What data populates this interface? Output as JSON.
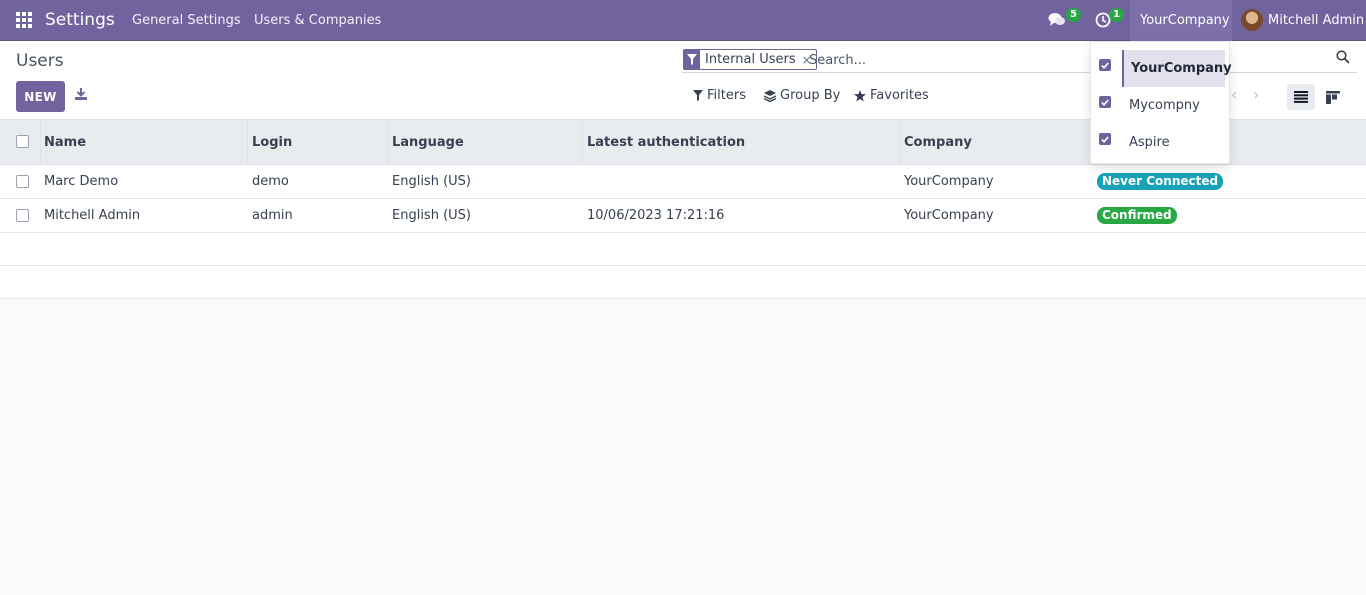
{
  "navbar": {
    "app_title": "Settings",
    "menu": [
      "General Settings",
      "Users & Companies"
    ],
    "messages_count": "5",
    "activities_count": "1",
    "company": "YourCompany",
    "user": "Mitchell Admin"
  },
  "control_panel": {
    "title": "Users",
    "new_label": "NEW",
    "facet_label": "Internal Users",
    "facet_close": "×",
    "search_placeholder": "Search...",
    "filters_label": "Filters",
    "groupby_label": "Group By",
    "favorites_label": "Favorites"
  },
  "table": {
    "columns": [
      "Name",
      "Login",
      "Language",
      "Latest authentication",
      "Company"
    ],
    "rows": [
      {
        "name": "Marc Demo",
        "login": "demo",
        "language": "English (US)",
        "latest_auth": "",
        "company": "YourCompany",
        "status": "Never Connected",
        "status_color": "#17a2b8"
      },
      {
        "name": "Mitchell Admin",
        "login": "admin",
        "language": "English (US)",
        "latest_auth": "10/06/2023 17:21:16",
        "company": "YourCompany",
        "status": "Confirmed",
        "status_color": "#28a745"
      }
    ]
  },
  "company_switcher": {
    "items": [
      {
        "label": "YourCompany",
        "checked": true,
        "active": true
      },
      {
        "label": "Mycompny",
        "checked": true,
        "active": false
      },
      {
        "label": "Aspire",
        "checked": true,
        "active": false
      }
    ]
  },
  "colors": {
    "brand": "#71639e",
    "badge_info": "#17a2b8",
    "badge_success": "#28a745"
  }
}
